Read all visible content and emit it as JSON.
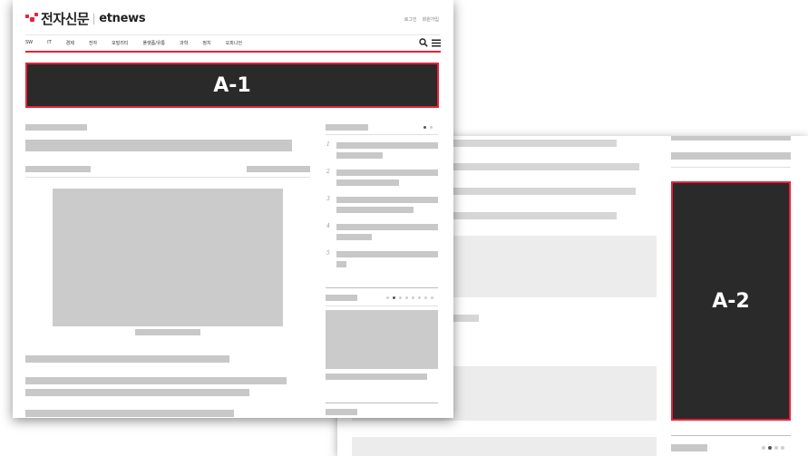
{
  "brand": {
    "name_ko": "전자신문",
    "name_en": "etnews",
    "accent_color": "#e8213a"
  },
  "header": {
    "links": [
      "로그인",
      "회원가입"
    ]
  },
  "nav": {
    "items": [
      "SW",
      "IT",
      "경제",
      "전자",
      "모빌리티",
      "플랫폼/유통",
      "과학",
      "정치",
      "오피니언"
    ],
    "icons": [
      "search-icon",
      "menu-icon"
    ]
  },
  "ads": {
    "a1_label": "A-1",
    "a2_label": "A-2"
  },
  "ranking": {
    "numbers": [
      "1",
      "2",
      "3",
      "4",
      "5"
    ]
  }
}
